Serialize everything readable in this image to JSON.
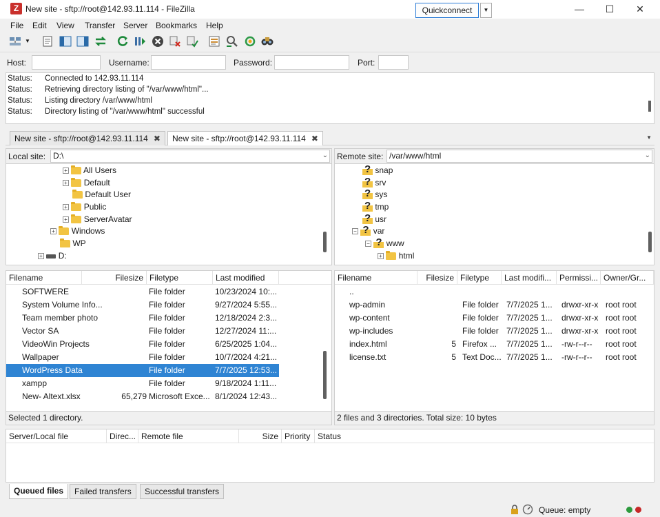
{
  "window": {
    "title": "New site - sftp://root@142.93.11.114 - FileZilla",
    "app_icon": "Z"
  },
  "menu": [
    "File",
    "Edit",
    "View",
    "Transfer",
    "Server",
    "Bookmarks",
    "Help"
  ],
  "toolbar_icons": [
    "site-manager-icon",
    "dropdown-arrow-icon",
    "message-log-icon",
    "local-tree-icon",
    "remote-tree-icon",
    "transfer-queue-icon",
    "refresh-icon",
    "process-queue-icon",
    "cancel-icon",
    "disconnect-icon",
    "reconnect-icon",
    "filter-icon",
    "compare-icon",
    "sync-browse-icon",
    "search-icon"
  ],
  "quickconnect": {
    "host_label": "Host:",
    "username_label": "Username:",
    "password_label": "Password:",
    "port_label": "Port:",
    "host_value": "",
    "username_value": "",
    "password_value": "",
    "port_value": "",
    "button_label": "Quickconnect"
  },
  "log": [
    {
      "key": "Status:",
      "value": "Connected to 142.93.11.114"
    },
    {
      "key": "Status:",
      "value": "Retrieving directory listing of \"/var/www/html\"..."
    },
    {
      "key": "Status:",
      "value": "Listing directory /var/www/html"
    },
    {
      "key": "Status:",
      "value": "Directory listing of \"/var/www/html\" successful"
    }
  ],
  "tabs": [
    {
      "label": "New site - sftp://root@142.93.11.114",
      "close": "✖"
    },
    {
      "label": "New site - sftp://root@142.93.11.114",
      "close": "✖"
    }
  ],
  "local": {
    "site_label": "Local site:",
    "path": "D:\\",
    "tree": [
      {
        "label": "All Users",
        "expander": "+"
      },
      {
        "label": "Default",
        "expander": "+"
      },
      {
        "label": "Default User",
        "expander": ""
      },
      {
        "label": "Public",
        "expander": "+"
      },
      {
        "label": "ServerAvatar",
        "expander": "+"
      },
      {
        "label": "Windows",
        "expander": "+"
      },
      {
        "label": "WP",
        "expander": ""
      },
      {
        "label": "D:",
        "expander": "+"
      }
    ],
    "columns": [
      "Filename",
      "Filesize",
      "Filetype",
      "Last modified"
    ],
    "files": [
      {
        "name": "SOFTWERE",
        "size": "",
        "type": "File folder",
        "modified": "10/23/2024 10:..."
      },
      {
        "name": "System Volume Info...",
        "size": "",
        "type": "File folder",
        "modified": "9/27/2024 5:55..."
      },
      {
        "name": "Team member photo",
        "size": "",
        "type": "File folder",
        "modified": "12/18/2024 2:3..."
      },
      {
        "name": "Vector SA",
        "size": "",
        "type": "File folder",
        "modified": "12/27/2024 11:..."
      },
      {
        "name": "VideoWin Projects",
        "size": "",
        "type": "File folder",
        "modified": "6/25/2025 1:04..."
      },
      {
        "name": "Wallpaper",
        "size": "",
        "type": "File folder",
        "modified": "10/7/2024 4:21..."
      },
      {
        "name": "WordPress Data",
        "size": "",
        "type": "File folder",
        "modified": "7/7/2025 12:53..."
      },
      {
        "name": "xampp",
        "size": "",
        "type": "File folder",
        "modified": "9/18/2024 1:11..."
      },
      {
        "name": "New- Altext.xlsx",
        "size": "65,279",
        "type": "Microsoft Exce...",
        "modified": "8/1/2024 12:43..."
      }
    ],
    "status": "Selected 1 directory."
  },
  "remote": {
    "site_label": "Remote site:",
    "path": "/var/www/html",
    "tree": [
      {
        "label": "snap",
        "expander": ""
      },
      {
        "label": "srv",
        "expander": ""
      },
      {
        "label": "sys",
        "expander": ""
      },
      {
        "label": "tmp",
        "expander": ""
      },
      {
        "label": "usr",
        "expander": ""
      },
      {
        "label": "var",
        "expander": "−"
      },
      {
        "label": "www",
        "expander": "−"
      },
      {
        "label": "html",
        "expander": "+"
      }
    ],
    "columns": [
      "Filename",
      "Filesize",
      "Filetype",
      "Last modifi...",
      "Permissi...",
      "Owner/Gr..."
    ],
    "files": [
      {
        "name": "..",
        "size": "",
        "type": "",
        "modified": "",
        "perm": "",
        "owner": ""
      },
      {
        "name": "wp-admin",
        "size": "",
        "type": "File folder",
        "modified": "7/7/2025 1...",
        "perm": "drwxr-xr-x",
        "owner": "root root"
      },
      {
        "name": "wp-content",
        "size": "",
        "type": "File folder",
        "modified": "7/7/2025 1...",
        "perm": "drwxr-xr-x",
        "owner": "root root"
      },
      {
        "name": "wp-includes",
        "size": "",
        "type": "File folder",
        "modified": "7/7/2025 1...",
        "perm": "drwxr-xr-x",
        "owner": "root root"
      },
      {
        "name": "index.html",
        "size": "5",
        "type": "Firefox ...",
        "modified": "7/7/2025 1...",
        "perm": "-rw-r--r--",
        "owner": "root root"
      },
      {
        "name": "license.txt",
        "size": "5",
        "type": "Text Doc...",
        "modified": "7/7/2025 1...",
        "perm": "-rw-r--r--",
        "owner": "root root"
      }
    ],
    "status": "2 files and 3 directories. Total size: 10 bytes"
  },
  "queue": {
    "columns": [
      "Server/Local file",
      "Direc...",
      "Remote file",
      "Size",
      "Priority",
      "Status"
    ],
    "tabs": [
      "Queued files",
      "Failed transfers",
      "Successful transfers"
    ]
  },
  "statusbar": {
    "queue": "Queue: empty"
  },
  "colors": {
    "selection": "#2f84d3",
    "accent_border": "#2a7bd6",
    "folder": "#f2c443"
  }
}
